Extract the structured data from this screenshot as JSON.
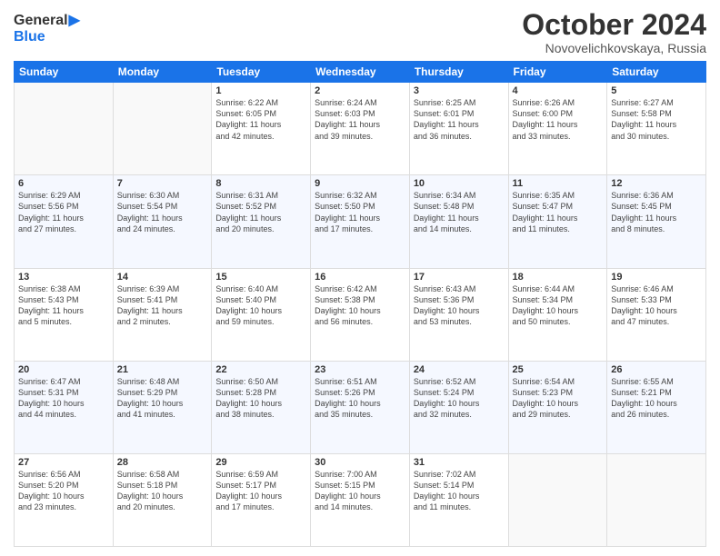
{
  "header": {
    "logo_general": "General",
    "logo_blue": "Blue",
    "month": "October 2024",
    "location": "Novovelichkovskaya, Russia"
  },
  "days_of_week": [
    "Sunday",
    "Monday",
    "Tuesday",
    "Wednesday",
    "Thursday",
    "Friday",
    "Saturday"
  ],
  "weeks": [
    [
      {
        "day": "",
        "info": ""
      },
      {
        "day": "",
        "info": ""
      },
      {
        "day": "1",
        "info": "Sunrise: 6:22 AM\nSunset: 6:05 PM\nDaylight: 11 hours\nand 42 minutes."
      },
      {
        "day": "2",
        "info": "Sunrise: 6:24 AM\nSunset: 6:03 PM\nDaylight: 11 hours\nand 39 minutes."
      },
      {
        "day": "3",
        "info": "Sunrise: 6:25 AM\nSunset: 6:01 PM\nDaylight: 11 hours\nand 36 minutes."
      },
      {
        "day": "4",
        "info": "Sunrise: 6:26 AM\nSunset: 6:00 PM\nDaylight: 11 hours\nand 33 minutes."
      },
      {
        "day": "5",
        "info": "Sunrise: 6:27 AM\nSunset: 5:58 PM\nDaylight: 11 hours\nand 30 minutes."
      }
    ],
    [
      {
        "day": "6",
        "info": "Sunrise: 6:29 AM\nSunset: 5:56 PM\nDaylight: 11 hours\nand 27 minutes."
      },
      {
        "day": "7",
        "info": "Sunrise: 6:30 AM\nSunset: 5:54 PM\nDaylight: 11 hours\nand 24 minutes."
      },
      {
        "day": "8",
        "info": "Sunrise: 6:31 AM\nSunset: 5:52 PM\nDaylight: 11 hours\nand 20 minutes."
      },
      {
        "day": "9",
        "info": "Sunrise: 6:32 AM\nSunset: 5:50 PM\nDaylight: 11 hours\nand 17 minutes."
      },
      {
        "day": "10",
        "info": "Sunrise: 6:34 AM\nSunset: 5:48 PM\nDaylight: 11 hours\nand 14 minutes."
      },
      {
        "day": "11",
        "info": "Sunrise: 6:35 AM\nSunset: 5:47 PM\nDaylight: 11 hours\nand 11 minutes."
      },
      {
        "day": "12",
        "info": "Sunrise: 6:36 AM\nSunset: 5:45 PM\nDaylight: 11 hours\nand 8 minutes."
      }
    ],
    [
      {
        "day": "13",
        "info": "Sunrise: 6:38 AM\nSunset: 5:43 PM\nDaylight: 11 hours\nand 5 minutes."
      },
      {
        "day": "14",
        "info": "Sunrise: 6:39 AM\nSunset: 5:41 PM\nDaylight: 11 hours\nand 2 minutes."
      },
      {
        "day": "15",
        "info": "Sunrise: 6:40 AM\nSunset: 5:40 PM\nDaylight: 10 hours\nand 59 minutes."
      },
      {
        "day": "16",
        "info": "Sunrise: 6:42 AM\nSunset: 5:38 PM\nDaylight: 10 hours\nand 56 minutes."
      },
      {
        "day": "17",
        "info": "Sunrise: 6:43 AM\nSunset: 5:36 PM\nDaylight: 10 hours\nand 53 minutes."
      },
      {
        "day": "18",
        "info": "Sunrise: 6:44 AM\nSunset: 5:34 PM\nDaylight: 10 hours\nand 50 minutes."
      },
      {
        "day": "19",
        "info": "Sunrise: 6:46 AM\nSunset: 5:33 PM\nDaylight: 10 hours\nand 47 minutes."
      }
    ],
    [
      {
        "day": "20",
        "info": "Sunrise: 6:47 AM\nSunset: 5:31 PM\nDaylight: 10 hours\nand 44 minutes."
      },
      {
        "day": "21",
        "info": "Sunrise: 6:48 AM\nSunset: 5:29 PM\nDaylight: 10 hours\nand 41 minutes."
      },
      {
        "day": "22",
        "info": "Sunrise: 6:50 AM\nSunset: 5:28 PM\nDaylight: 10 hours\nand 38 minutes."
      },
      {
        "day": "23",
        "info": "Sunrise: 6:51 AM\nSunset: 5:26 PM\nDaylight: 10 hours\nand 35 minutes."
      },
      {
        "day": "24",
        "info": "Sunrise: 6:52 AM\nSunset: 5:24 PM\nDaylight: 10 hours\nand 32 minutes."
      },
      {
        "day": "25",
        "info": "Sunrise: 6:54 AM\nSunset: 5:23 PM\nDaylight: 10 hours\nand 29 minutes."
      },
      {
        "day": "26",
        "info": "Sunrise: 6:55 AM\nSunset: 5:21 PM\nDaylight: 10 hours\nand 26 minutes."
      }
    ],
    [
      {
        "day": "27",
        "info": "Sunrise: 6:56 AM\nSunset: 5:20 PM\nDaylight: 10 hours\nand 23 minutes."
      },
      {
        "day": "28",
        "info": "Sunrise: 6:58 AM\nSunset: 5:18 PM\nDaylight: 10 hours\nand 20 minutes."
      },
      {
        "day": "29",
        "info": "Sunrise: 6:59 AM\nSunset: 5:17 PM\nDaylight: 10 hours\nand 17 minutes."
      },
      {
        "day": "30",
        "info": "Sunrise: 7:00 AM\nSunset: 5:15 PM\nDaylight: 10 hours\nand 14 minutes."
      },
      {
        "day": "31",
        "info": "Sunrise: 7:02 AM\nSunset: 5:14 PM\nDaylight: 10 hours\nand 11 minutes."
      },
      {
        "day": "",
        "info": ""
      },
      {
        "day": "",
        "info": ""
      }
    ]
  ]
}
